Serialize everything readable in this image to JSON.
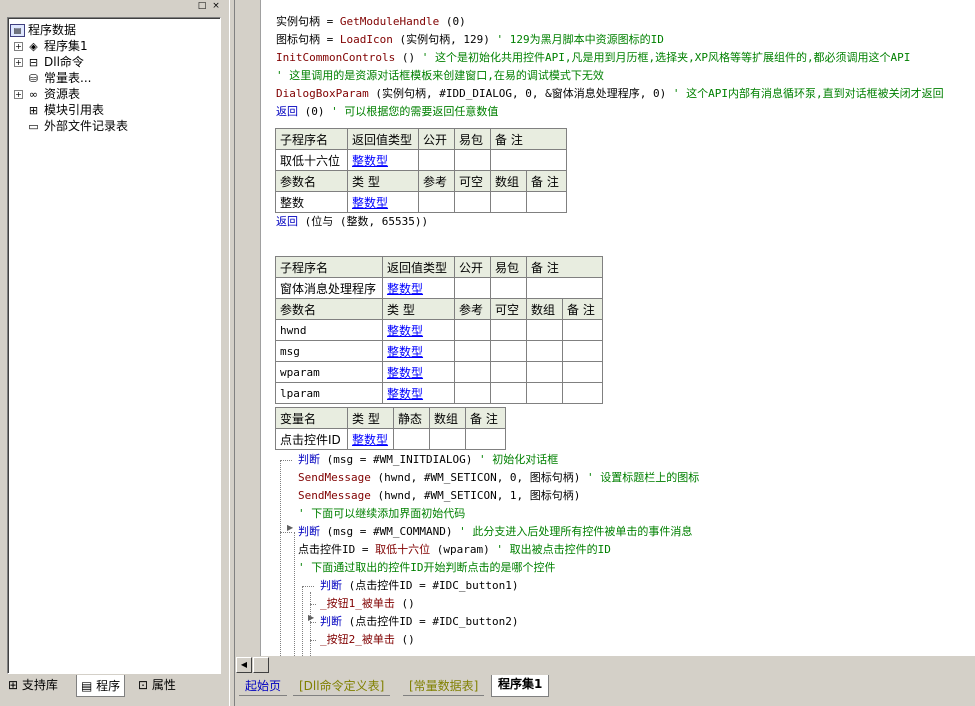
{
  "tree": {
    "root": "程序数据",
    "items": [
      {
        "label": "程序集1",
        "icon": "assembly-icon",
        "expander": "+"
      },
      {
        "label": "Dll命令",
        "icon": "dll-icon",
        "expander": "+"
      },
      {
        "label": "常量表...",
        "icon": "constant-icon",
        "expander": ""
      },
      {
        "label": "资源表",
        "icon": "resource-icon",
        "expander": "+"
      },
      {
        "label": "模块引用表",
        "icon": "module-icon",
        "expander": ""
      },
      {
        "label": "外部文件记录表",
        "icon": "file-icon",
        "expander": ""
      }
    ]
  },
  "left_tabs": [
    "支持库",
    "程序",
    "属性"
  ],
  "bottom_tabs": [
    "起始页",
    "[Dll命令定义表]",
    "[常量数据表]",
    "程序集1"
  ],
  "code": {
    "l1": {
      "a": "实例句柄",
      "b": " = ",
      "c": "GetModuleHandle",
      "d": " (0)"
    },
    "l2": {
      "a": "图标句柄",
      "b": " = ",
      "c": "LoadIcon",
      "d": " (实例句柄, 129)",
      "e": "  ' 129为黑月脚本中资源图标的ID"
    },
    "l3": {
      "c": "InitCommonControls",
      "d": " ()",
      "e": "  ' 这个是初始化共用控件API,凡是用到月历框,选择夹,XP风格等等扩展组件的,都必须调用这个API"
    },
    "l4": {
      "e": "' 这里调用的是资源对话框模板来创建窗口,在易的调试模式下无效"
    },
    "l5": {
      "c": "DialogBoxParam",
      "d": " (实例句柄, #IDD_DIALOG, 0, &窗体消息处理程序, 0)",
      "e": "  ' 这个API内部有消息循环泵,直到对话框被关闭才返回"
    },
    "l6": {
      "k": "返回",
      "d": " (0)",
      "e": "  ' 可以根据您的需要返回任意数值"
    },
    "l7": {
      "k": "返回",
      "d": " (位与 (整数, 65535))"
    },
    "l8": {
      "k": "判断",
      "d": " (msg = #WM_INITDIALOG)",
      "e": "  ' 初始化对话框"
    },
    "l9": {
      "c": "SendMessage",
      "d": " (hwnd, #WM_SETICON, 0, 图标句柄)",
      "e": "  ' 设置标题栏上的图标"
    },
    "l10": {
      "c": "SendMessage",
      "d": " (hwnd, #WM_SETICON, 1, 图标句柄)"
    },
    "l11": {
      "e": "' 下面可以继续添加界面初始代码"
    },
    "l12": {
      "k": "判断",
      "d": " (msg = #WM_COMMAND)",
      "e": "  ' 此分支进入后处理所有控件被单击的事件消息"
    },
    "l13": {
      "a": "点击控件ID",
      "b": " = ",
      "c": "取低十六位",
      "d": " (wparam)",
      "e": "  ' 取出被点击控件的ID"
    },
    "l14": {
      "e": "' 下面通过取出的控件ID开始判断点击的是哪个控件"
    },
    "l15": {
      "k": "判断",
      "d": " (点击控件ID = #IDC_button1)"
    },
    "l16": {
      "c": "_按钮1_被单击",
      "d": " ()"
    },
    "l17": {
      "k": "判断",
      "d": " (点击控件ID = #IDC_button2)"
    },
    "l18": {
      "c": "_按钮2_被单击",
      "d": " ()"
    }
  },
  "table1": {
    "h1": [
      "子程序名",
      "返回值类型",
      "公开",
      "易包",
      "备 注"
    ],
    "r1": [
      "取低十六位",
      "整数型",
      "",
      "",
      ""
    ],
    "h2": [
      "参数名",
      "类 型",
      "参考",
      "可空",
      "数组",
      "备 注"
    ],
    "r2": [
      "整数",
      "整数型",
      "",
      "",
      "",
      ""
    ]
  },
  "table2": {
    "h1": [
      "子程序名",
      "返回值类型",
      "公开",
      "易包",
      "备 注"
    ],
    "r1": [
      "窗体消息处理程序",
      "整数型",
      "",
      "",
      ""
    ],
    "h2": [
      "参数名",
      "类 型",
      "参考",
      "可空",
      "数组",
      "备 注"
    ],
    "params": [
      [
        "hwnd",
        "整数型"
      ],
      [
        "msg",
        "整数型"
      ],
      [
        "wparam",
        "整数型"
      ],
      [
        "lparam",
        "整数型"
      ]
    ]
  },
  "table3": {
    "h": [
      "变量名",
      "类 型",
      "静态",
      "数组",
      "备 注"
    ],
    "r": [
      "点击控件ID",
      "整数型",
      "",
      "",
      ""
    ]
  }
}
